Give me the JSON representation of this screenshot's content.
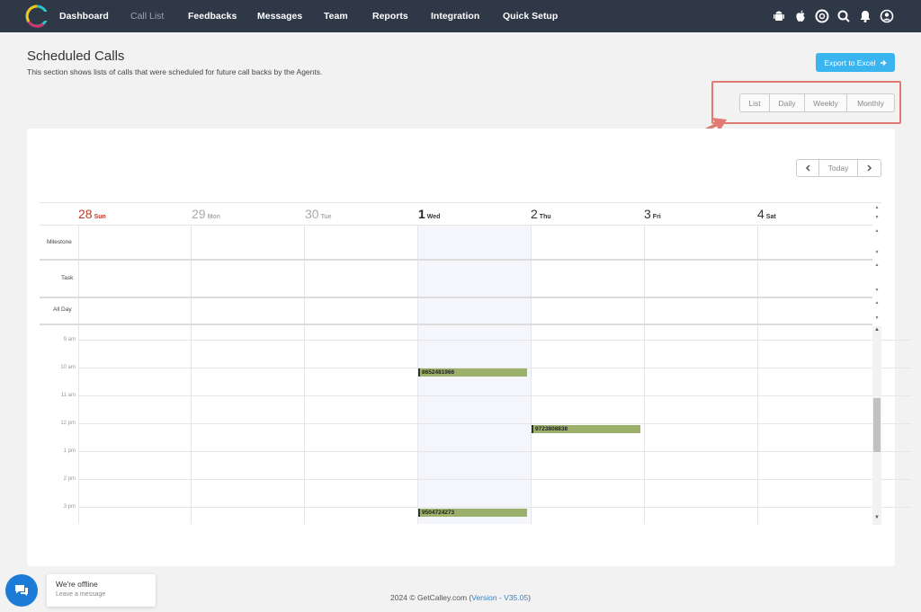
{
  "nav": {
    "items": [
      "Dashboard",
      "Call List",
      "Feedbacks",
      "Messages",
      "Team",
      "Reports",
      "Integration",
      "Quick Setup"
    ],
    "active": "Call List",
    "icons": [
      "android-icon",
      "apple-icon",
      "help-icon",
      "search-icon",
      "bell-icon",
      "user-icon"
    ]
  },
  "page": {
    "title": "Scheduled Calls",
    "description": "This section shows lists of calls that were scheduled for future call backs by the Agents.",
    "export_label": "Export to Excel"
  },
  "views": [
    "List",
    "Daily",
    "Weekly",
    "Monthly"
  ],
  "calendar_nav": {
    "prev": "<",
    "today": "Today",
    "next": ">"
  },
  "days": [
    {
      "num": "28",
      "name": "Sun"
    },
    {
      "num": "29",
      "name": "Mon"
    },
    {
      "num": "30",
      "name": "Tue"
    },
    {
      "num": "1",
      "name": "Wed"
    },
    {
      "num": "2",
      "name": "Thu"
    },
    {
      "num": "3",
      "name": "Fri"
    },
    {
      "num": "4",
      "name": "Sat"
    }
  ],
  "rows": [
    "Milestone",
    "Task",
    "All Day"
  ],
  "times": [
    "9 am",
    "10 am",
    "11 am",
    "12 pm",
    "1 pm",
    "2 pm",
    "3 pm"
  ],
  "events": [
    {
      "phone": "8652481966",
      "day": "Wed",
      "time": "10 am"
    },
    {
      "phone": "9723808838",
      "day": "Thu",
      "time": "12 pm"
    },
    {
      "phone": "9504724273",
      "day": "Wed",
      "time": "3 pm"
    }
  ],
  "chat": {
    "title": "We're offline",
    "subtitle": "Leave a message"
  },
  "footer": {
    "copyright": "2024 © GetCalley.com (",
    "version_label": "Version - V35.05",
    "close": ")"
  },
  "colors": {
    "nav_bg": "#2f3847",
    "accent": "#3bb5ef",
    "event": "#9bb06b",
    "highlight": "#e07a72",
    "sunday": "#c0392b"
  }
}
